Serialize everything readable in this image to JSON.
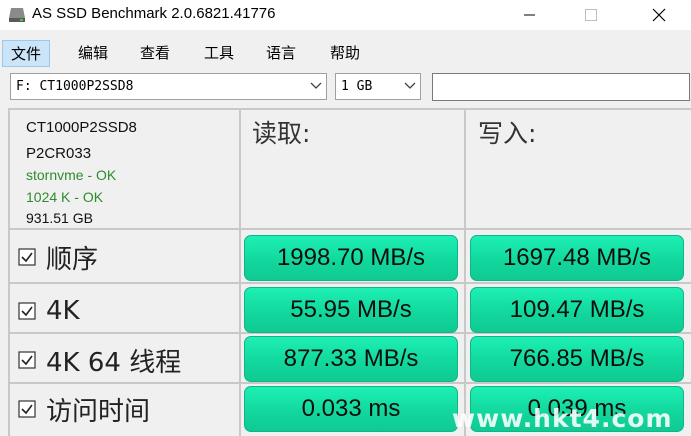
{
  "window": {
    "title": "AS SSD Benchmark 2.0.6821.41776"
  },
  "menu": [
    "文件",
    "编辑",
    "查看",
    "工具",
    "语言",
    "帮助"
  ],
  "drive_select": {
    "value": "F: CT1000P2SSD8"
  },
  "size_select": {
    "value": "1 GB"
  },
  "extra_field": {
    "value": ""
  },
  "drive_info": {
    "model": "CT1000P2SSD8",
    "firmware": "P2CR033",
    "driver": "stornvme - OK",
    "alignment": "1024 K - OK",
    "capacity": "931.51 GB"
  },
  "columns": {
    "read": "读取:",
    "write": "写入:"
  },
  "rows": [
    {
      "label": "顺序",
      "read": "1998.70 MB/s",
      "write": "1697.48 MB/s"
    },
    {
      "label": "4K",
      "read": "55.95 MB/s",
      "write": "109.47 MB/s"
    },
    {
      "label": "4K 64 线程",
      "read": "877.33 MB/s",
      "write": "766.85 MB/s"
    },
    {
      "label": "访问时间",
      "read": "0.033 ms",
      "write": "0.039 ms"
    }
  ],
  "watermark": "www.hkt4.com",
  "colors": {
    "result_green": "#12d89e",
    "ok_green": "#2e8b2e"
  }
}
